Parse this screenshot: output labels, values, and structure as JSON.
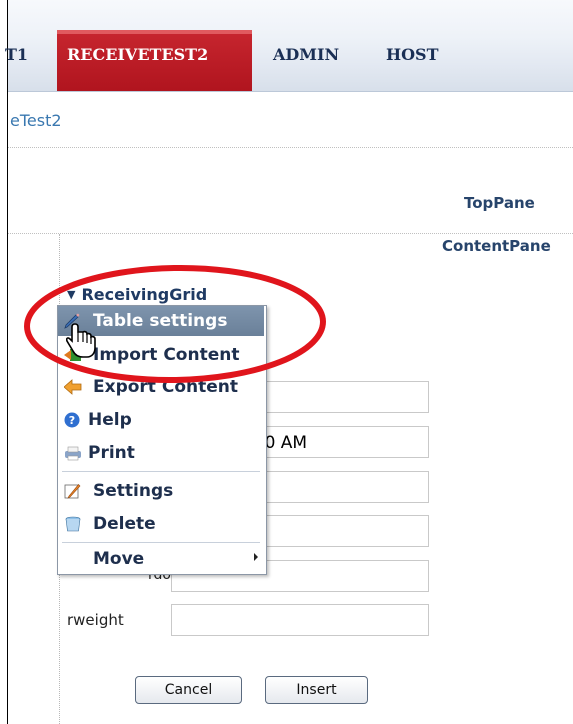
{
  "nav": {
    "tabs": [
      {
        "label": "T1"
      },
      {
        "label": "RECEIVETEST2",
        "active": true
      },
      {
        "label": "ADMIN"
      },
      {
        "label": "HOST"
      }
    ]
  },
  "breadcrumb": {
    "text": "eTest2"
  },
  "panes": {
    "top": "TopPane",
    "content": "ContentPane"
  },
  "module": {
    "title": "ReceivingGrid"
  },
  "form": {
    "field2_value": "48 12:00:00 AM",
    "label_dob_partial": "rdob",
    "label_weight": "rweight"
  },
  "buttons": {
    "cancel": "Cancel",
    "insert": "Insert"
  },
  "menu": {
    "items": [
      {
        "label": "Table settings",
        "icon": "pencil-icon",
        "highlighted": true
      },
      {
        "label": "Import Content",
        "icon": "import-icon"
      },
      {
        "label": "Export Content",
        "icon": "export-icon"
      },
      {
        "label": "Help",
        "icon": "help-icon"
      },
      {
        "label": "Print",
        "icon": "print-icon"
      },
      {
        "label": "Settings",
        "icon": "settings-icon"
      },
      {
        "label": "Delete",
        "icon": "delete-icon"
      },
      {
        "label": "Move",
        "icon": "submenu-arrow-icon"
      }
    ]
  },
  "colors": {
    "active_tab": "#c01f28",
    "highlight_ring": "#e0151c",
    "menu_highlight": "#748aa3"
  }
}
